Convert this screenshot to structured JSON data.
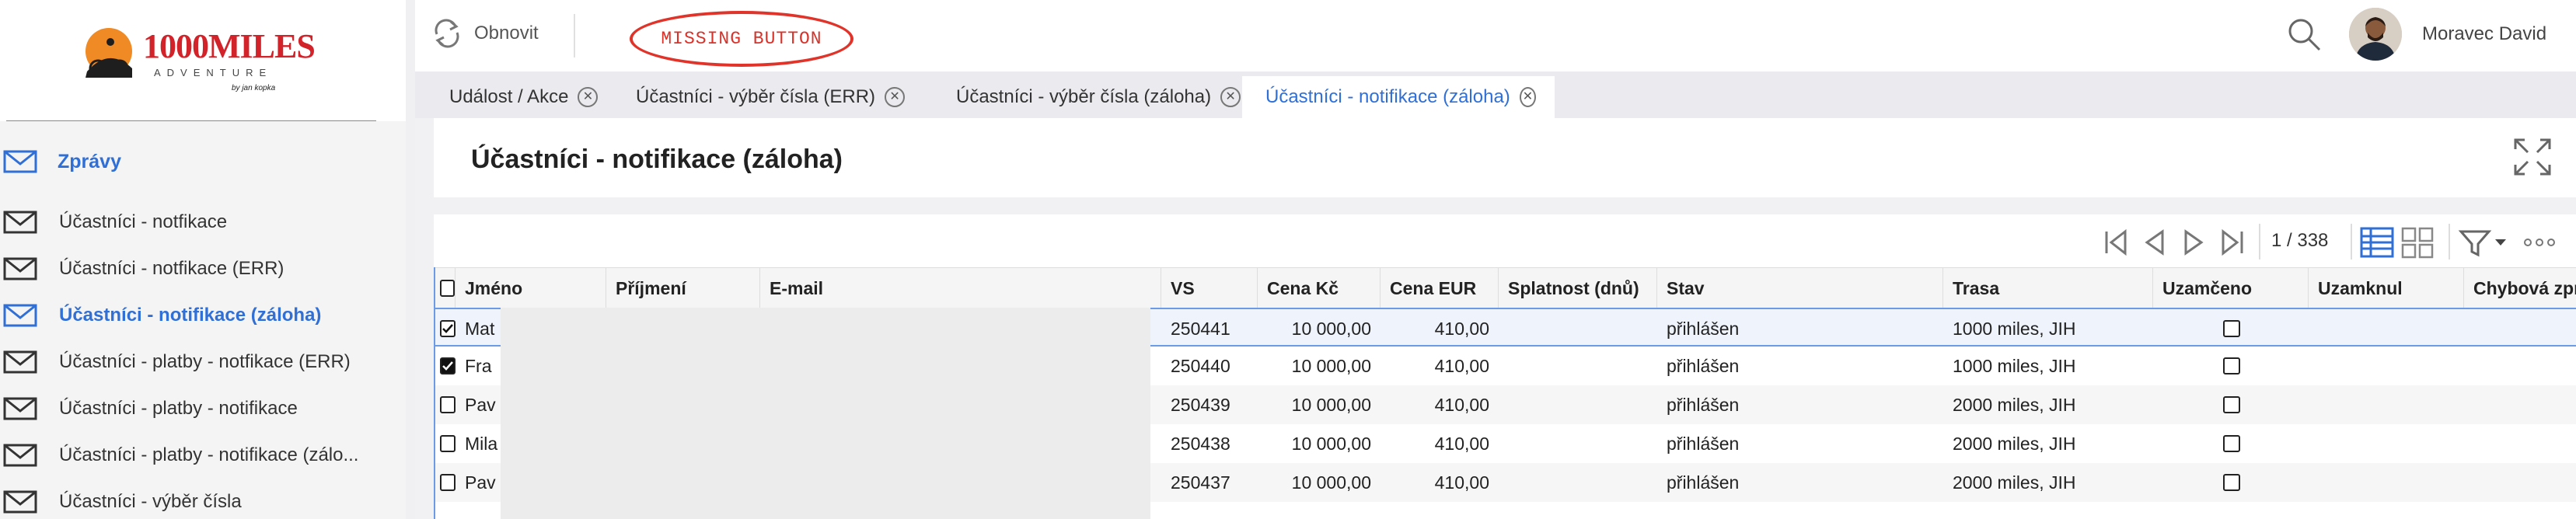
{
  "app": {
    "logo_text": "1000MILES",
    "logo_sub": "ADVENTURE",
    "logo_by": "by jan kopka"
  },
  "toolbar": {
    "refresh_label": "Obnovit",
    "missing_label": "MISSING BUTTON",
    "user_name": "Moravec David"
  },
  "sidebar": {
    "header": "Zprávy",
    "items": [
      {
        "label": "Účastníci - notfikace",
        "active": false
      },
      {
        "label": "Účastníci - notfikace (ERR)",
        "active": false
      },
      {
        "label": "Účastníci - notifikace (záloha)",
        "active": true
      },
      {
        "label": "Účastníci - platby - notfikace (ERR)",
        "active": false
      },
      {
        "label": "Účastníci - platby - notifikace",
        "active": false
      },
      {
        "label": "Účastníci - platby - notifikace (zálo...",
        "active": false
      },
      {
        "label": "Účastníci - výběr čísla",
        "active": false
      }
    ]
  },
  "tabs": [
    {
      "label": "Událost / Akce",
      "active": false
    },
    {
      "label": "Účastníci - výběr čísla (ERR)",
      "active": false
    },
    {
      "label": "Účastníci - výběr čísla (záloha)",
      "active": false
    },
    {
      "label": "Účastníci - notifikace (záloha)",
      "active": true
    }
  ],
  "page": {
    "title": "Účastníci - notifikace (záloha)",
    "pager": "1 / 338"
  },
  "table": {
    "columns": [
      "Jméno",
      "Příjmení",
      "E-mail",
      "VS",
      "Cena Kč",
      "Cena EUR",
      "Splatnost (dnů)",
      "Stav",
      "Trasa",
      "Uzamčeno",
      "Uzamknul",
      "Chybová zpráva"
    ],
    "rows": [
      {
        "checked": true,
        "jmeno": "Mat",
        "vs": "250441",
        "cena_kc": "10 000,00",
        "cena_eur": "410,00",
        "stav": "přihlášen",
        "trasa": "1000 miles, JIH"
      },
      {
        "checked": true,
        "jmeno": "Fra",
        "vs": "250440",
        "cena_kc": "10 000,00",
        "cena_eur": "410,00",
        "stav": "přihlášen",
        "trasa": "1000 miles, JIH"
      },
      {
        "checked": false,
        "jmeno": "Pav",
        "vs": "250439",
        "cena_kc": "10 000,00",
        "cena_eur": "410,00",
        "stav": "přihlášen",
        "trasa": "2000 miles, JIH"
      },
      {
        "checked": false,
        "jmeno": "Mila",
        "vs": "250438",
        "cena_kc": "10 000,00",
        "cena_eur": "410,00",
        "stav": "přihlášen",
        "trasa": "2000 miles, JIH"
      },
      {
        "checked": false,
        "jmeno": "Pav",
        "vs": "250437",
        "cena_kc": "10 000,00",
        "cena_eur": "410,00",
        "stav": "přihlášen",
        "trasa": "2000 miles, JIH"
      }
    ]
  },
  "colors": {
    "accent": "#2f6fd6",
    "missing": "#d8332b",
    "brand": "#d2232a"
  }
}
